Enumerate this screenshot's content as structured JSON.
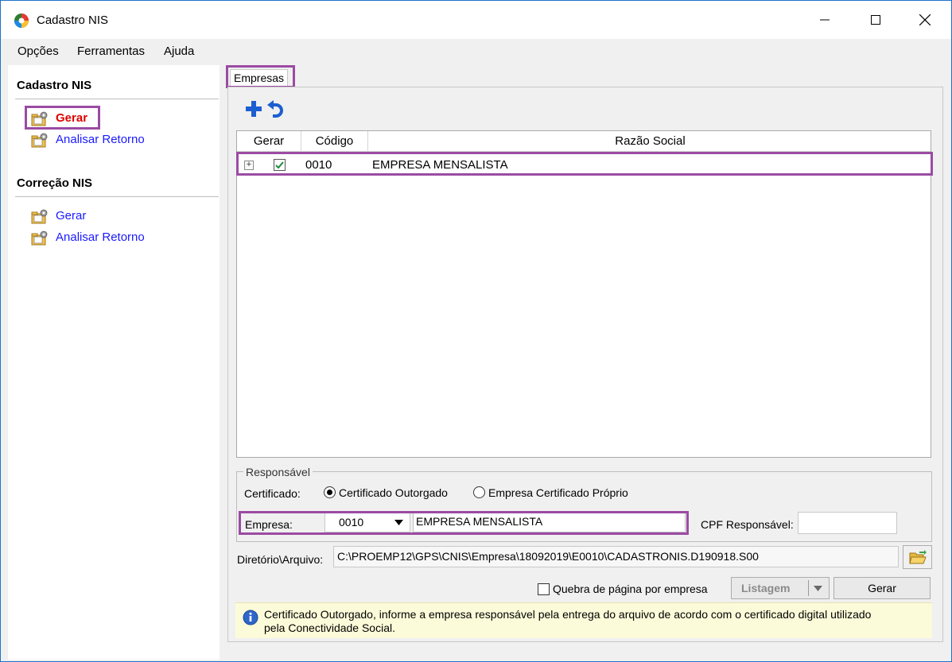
{
  "window": {
    "title": "Cadastro NIS",
    "controls": [
      "minimize",
      "maximize",
      "close"
    ]
  },
  "menu": {
    "items": [
      "Opções",
      "Ferramentas",
      "Ajuda"
    ]
  },
  "sidebar": {
    "sections": [
      {
        "heading": "Cadastro NIS",
        "items": [
          {
            "label": "Gerar",
            "active": true,
            "icon": "folder-gear-icon"
          },
          {
            "label": "Analisar Retorno",
            "active": false,
            "icon": "folder-gear-icon"
          }
        ]
      },
      {
        "heading": "Correção NIS",
        "items": [
          {
            "label": "Gerar",
            "active": false,
            "icon": "folder-gear-icon"
          },
          {
            "label": "Analisar Retorno",
            "active": false,
            "icon": "folder-gear-icon"
          }
        ]
      }
    ]
  },
  "tabs": [
    {
      "label": "Empresas",
      "selected": true
    }
  ],
  "toolbar": {
    "add_icon": "plus-icon",
    "undo_icon": "undo-icon"
  },
  "grid": {
    "columns": [
      "Gerar",
      "Código",
      "Razão Social"
    ],
    "rows": [
      {
        "expanded": false,
        "gerar": true,
        "codigo": "0010",
        "razao_social": "EMPRESA MENSALISTA"
      }
    ]
  },
  "responsavel": {
    "legend": "Responsável",
    "certificado_label": "Certificado:",
    "options": [
      {
        "label": "Certificado Outorgado",
        "selected": true
      },
      {
        "label": "Empresa Certificado Próprio",
        "selected": false
      }
    ],
    "empresa_label": "Empresa:",
    "empresa_code": "0010",
    "empresa_name": "EMPRESA MENSALISTA",
    "cpf_label": "CPF Responsável:",
    "cpf_value": ""
  },
  "diretorio": {
    "label": "Diretório\\Arquivo:",
    "value": "C:\\PROEMP12\\GPS\\CNIS\\Empresa\\18092019\\E0010\\CADASTRONIS.D190918.S00",
    "browse_icon": "open-folder-icon"
  },
  "options": {
    "quebra_label": "Quebra de página por empresa",
    "quebra_checked": false
  },
  "buttons": {
    "listagem": "Listagem",
    "gerar": "Gerar"
  },
  "info": {
    "icon": "info-icon",
    "line1": "Certificado Outorgado, informe a empresa responsável pela entrega do arquivo de acordo com o certificado digital utilizado",
    "line2": "pela Conectividade Social."
  },
  "colors": {
    "highlight": "#9b4ba3",
    "link": "#1a1aff",
    "active_link": "#e00000",
    "info_bg": "#fcfbd9",
    "window_border": "#1a73c9"
  }
}
